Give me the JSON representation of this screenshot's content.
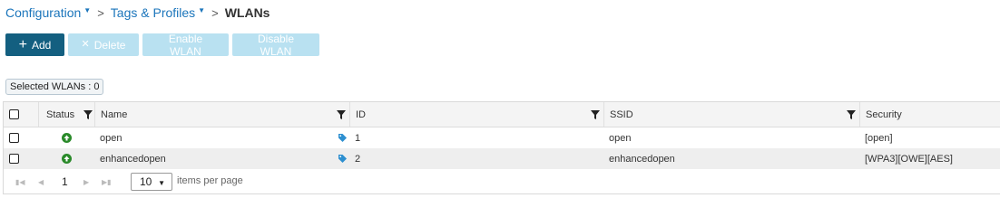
{
  "breadcrumb": {
    "items": [
      {
        "label": "Configuration",
        "dropdown": true
      },
      {
        "label": "Tags & Profiles",
        "dropdown": true
      }
    ],
    "separator": ">",
    "current": "WLANs"
  },
  "toolbar": {
    "add_label": "Add",
    "add_icon": "+",
    "delete_label": "Delete",
    "delete_icon": "✕",
    "enable_label": "Enable WLAN",
    "disable_label": "Disable WLAN"
  },
  "selected": {
    "label": "Selected WLANs : 0"
  },
  "table": {
    "columns": {
      "status": "Status",
      "name": "Name",
      "id": "ID",
      "ssid": "SSID",
      "security": "Security"
    },
    "rows": [
      {
        "status": "up",
        "name": "open",
        "id": "1",
        "ssid": "open",
        "security": "[open]"
      },
      {
        "status": "up",
        "name": "enhancedopen",
        "id": "2",
        "ssid": "enhancedopen",
        "security": "[WPA3][OWE][AES]"
      }
    ]
  },
  "pager": {
    "current_page": "1",
    "page_size": "10",
    "items_per_page_label": "items per page"
  },
  "colors": {
    "link": "#1b75bb",
    "primary_button": "#135f80",
    "disabled_button": "#b9e1f1",
    "status_up": "#2a8a2a",
    "tag_icon": "#2d8fd0"
  }
}
